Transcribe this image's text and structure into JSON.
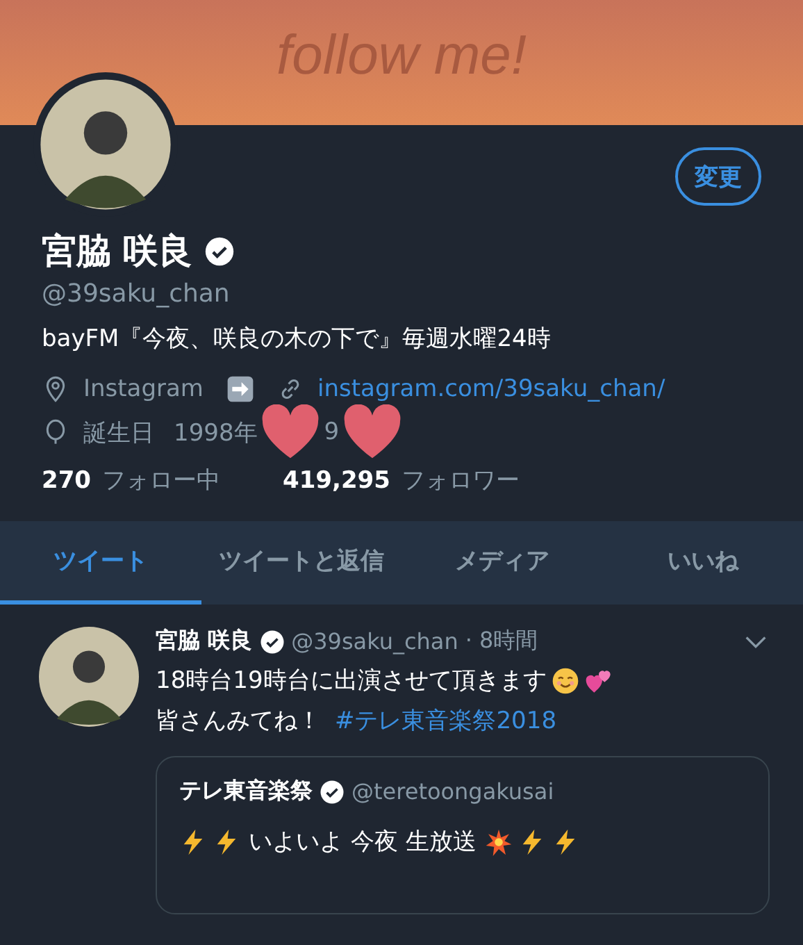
{
  "banner": {
    "text": "follow me!"
  },
  "profile": {
    "edit_button": "変更",
    "name": "宮脇 咲良",
    "verified": true,
    "handle": "@39saku_chan",
    "bio": "bayFM『今夜、咲良の木の下で』毎週水曜24時",
    "location": "Instagram",
    "link": "instagram.com/39saku_chan/",
    "birthday_label": "誕生日",
    "birthday_parts": [
      "1998年",
      "9"
    ]
  },
  "stats": [
    {
      "count": "270",
      "label": "フォロー中"
    },
    {
      "count": "419,295",
      "label": "フォロワー"
    }
  ],
  "tabs": [
    {
      "label": "ツイート",
      "selected": true
    },
    {
      "label": "ツイートと返信",
      "selected": false
    },
    {
      "label": "メディア",
      "selected": false
    },
    {
      "label": "いいね",
      "selected": false
    }
  ],
  "tweet": {
    "name": "宮脇 咲良",
    "verified": true,
    "handle": "@39saku_chan",
    "time": "· 8時間",
    "lines": [
      "18時台19時台に出演させて頂きます"
    ],
    "line2_text": "皆さんみてね！",
    "hashtag": "#テレ東音楽祭2018",
    "quote": {
      "name": "テレ東音楽祭",
      "verified": true,
      "handle": "@teretoongakusai",
      "text_parts": [
        "いよいよ 今夜 生放送"
      ]
    }
  }
}
